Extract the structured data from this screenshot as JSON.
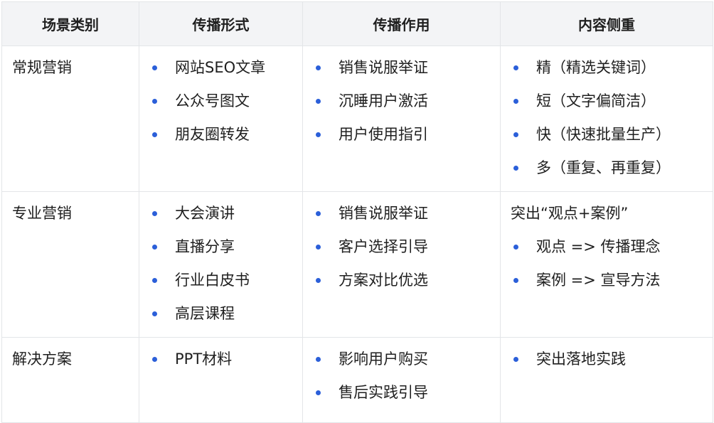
{
  "headers": [
    "场景类别",
    "传播形式",
    "传播作用",
    "内容侧重"
  ],
  "rows": [
    {
      "category": "常规营销",
      "forms": [
        "网站SEO文章",
        "公众号图文",
        "朋友圈转发"
      ],
      "effects": [
        "销售说服举证",
        "沉睡用户激活",
        "用户使用指引"
      ],
      "focus_intro": "",
      "focus": [
        "精（精选关键词）",
        "短（文字偏简洁）",
        "快（快速批量生产）",
        "多（重复、再重复）"
      ]
    },
    {
      "category": "专业营销",
      "forms": [
        "大会演讲",
        "直播分享",
        "行业白皮书",
        "高层课程"
      ],
      "effects": [
        "销售说服举证",
        "客户选择引导",
        "方案对比优选"
      ],
      "focus_intro": "突出“观点+案例”",
      "focus": [
        "观点 => 传播理念",
        "案例 => 宣导方法"
      ]
    },
    {
      "category": "解决方案",
      "forms": [
        "PPT材料"
      ],
      "effects": [
        "影响用户购买",
        "售后实践引导"
      ],
      "focus_intro": "",
      "focus": [
        "突出落地实践"
      ]
    }
  ],
  "colors": {
    "bullet": "#2b5fd9",
    "header_bg": "#f3f4f6",
    "border": "#e3e5e8"
  }
}
